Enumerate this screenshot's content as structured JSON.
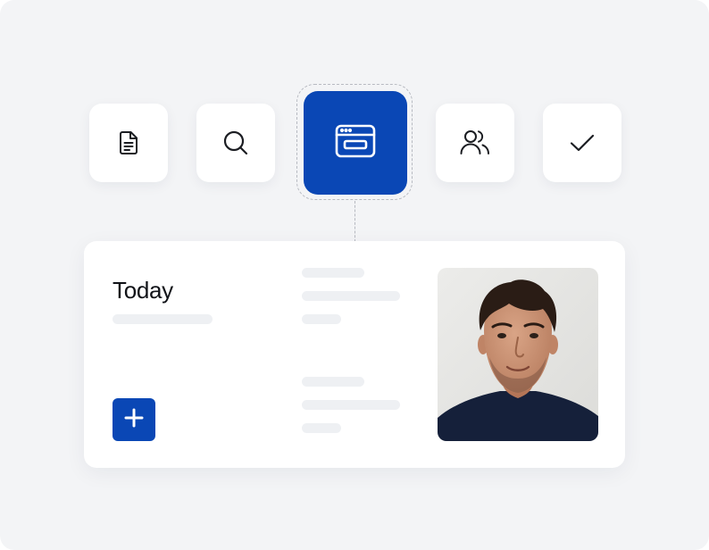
{
  "colors": {
    "accent": "#0a47b5",
    "icon_stroke": "#1b1d22",
    "background": "#f3f4f6"
  },
  "toolbar": {
    "tiles": [
      {
        "icon": "document-icon",
        "selected": false
      },
      {
        "icon": "search-icon",
        "selected": false
      },
      {
        "icon": "browser-window-icon",
        "selected": true
      },
      {
        "icon": "users-icon",
        "selected": false
      },
      {
        "icon": "checkmark-icon",
        "selected": false
      }
    ]
  },
  "card": {
    "title": "Today",
    "add_button_icon": "plus-icon",
    "photo": "portrait-photo"
  }
}
